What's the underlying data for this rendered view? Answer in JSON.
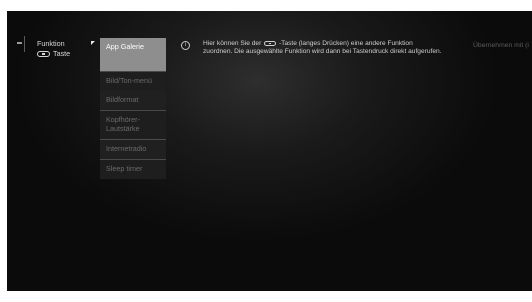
{
  "function_label": {
    "line1": "Funktion",
    "line2": "Taste"
  },
  "menu": {
    "items": [
      {
        "label": "App Galerie"
      },
      {
        "label": "Bild/Ton-menü"
      },
      {
        "label": "Bildformat"
      },
      {
        "label": "Kopfhörer-Lautstärke"
      },
      {
        "label": "Internetradio"
      },
      {
        "label": "Sleep timer"
      }
    ],
    "selected_index": 0
  },
  "info": {
    "part1": "Hier können Sie der",
    "part2": "-Taste (langes Drücken) eine andere Funktion zuordnen. Die ausgewählte Funktion wird dann bei Tastendruck direkt aufgerufen."
  },
  "apply_hint": "Übernehmen mit (i",
  "colors": {
    "selected_background": "#8e8e8e",
    "text": "#cfcfcf",
    "muted_text": "#6a6a6a"
  },
  "icons": {
    "info": "info-circle-icon",
    "key": "button-key-icon",
    "chevron": "corner-arrow-icon"
  }
}
